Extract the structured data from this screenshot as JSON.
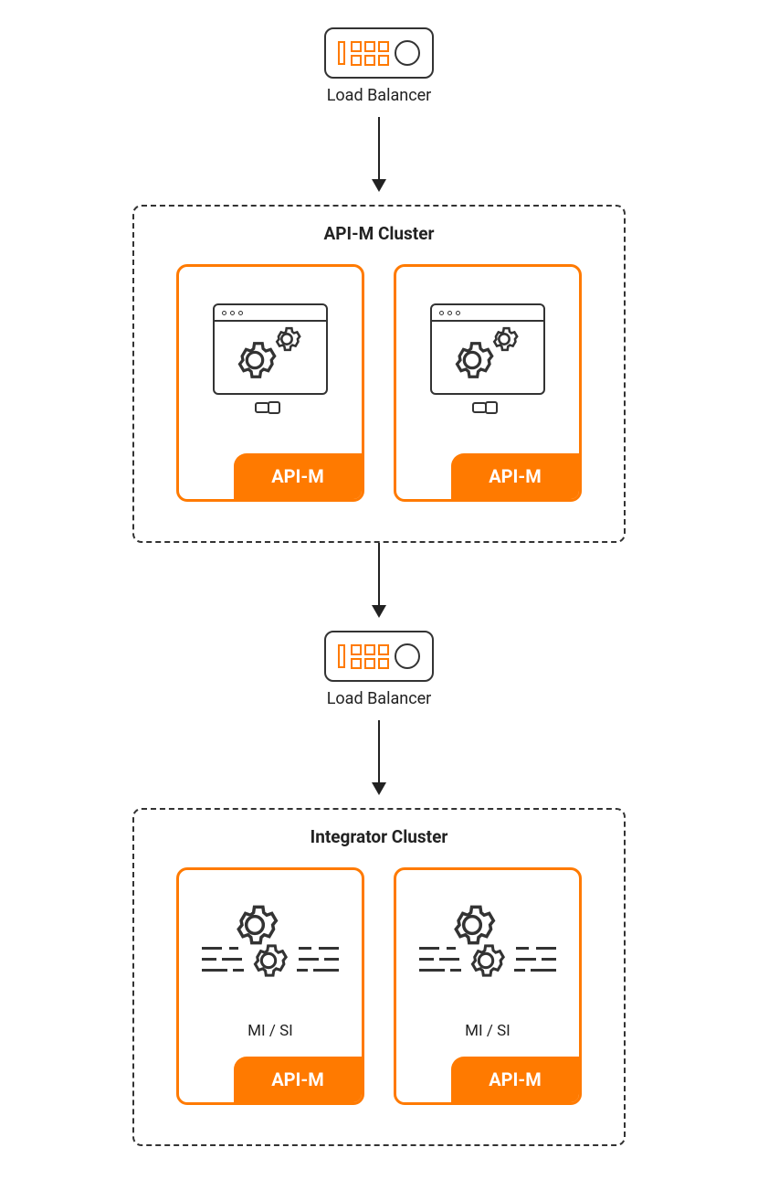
{
  "lb1": {
    "label": "Load Balancer"
  },
  "lb2": {
    "label": "Load Balancer"
  },
  "cluster1": {
    "title": "API-M Cluster",
    "cards": [
      {
        "badge": "API-M"
      },
      {
        "badge": "API-M"
      }
    ]
  },
  "cluster2": {
    "title": "Integrator Cluster",
    "cards": [
      {
        "badge": "API-M",
        "sub": "MI / SI"
      },
      {
        "badge": "API-M",
        "sub": "MI / SI"
      }
    ]
  }
}
